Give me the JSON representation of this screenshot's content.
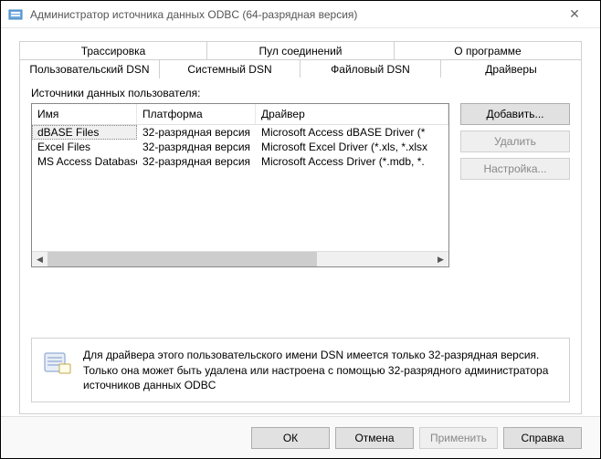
{
  "window": {
    "title": "Администратор источника данных ODBC (64-разрядная версия)"
  },
  "tabs": {
    "tracing": "Трассировка",
    "pooling": "Пул соединений",
    "about": "О программе",
    "user_dsn": "Пользовательский DSN",
    "system_dsn": "Системный DSN",
    "file_dsn": "Файловый DSN",
    "drivers": "Драйверы"
  },
  "section_label": "Источники данных пользователя:",
  "columns": {
    "name": "Имя",
    "platform": "Платформа",
    "driver": "Драйвер"
  },
  "rows": [
    {
      "name": "dBASE Files",
      "platform": "32-разрядная версия",
      "driver": "Microsoft Access dBASE Driver (*"
    },
    {
      "name": "Excel Files",
      "platform": "32-разрядная версия",
      "driver": "Microsoft Excel Driver (*.xls, *.xlsx"
    },
    {
      "name": "MS Access Database",
      "platform": "32-разрядная версия",
      "driver": "Microsoft Access Driver (*.mdb, *."
    }
  ],
  "buttons": {
    "add": "Добавить...",
    "remove": "Удалить",
    "configure": "Настройка..."
  },
  "info": "Для драйвера этого пользовательского имени DSN имеется только 32-разрядная версия. Только она может быть удалена или настроена с помощью 32-разрядного администратора источников данных ODBC",
  "footer": {
    "ok": "ОК",
    "cancel": "Отмена",
    "apply": "Применить",
    "help": "Справка"
  }
}
